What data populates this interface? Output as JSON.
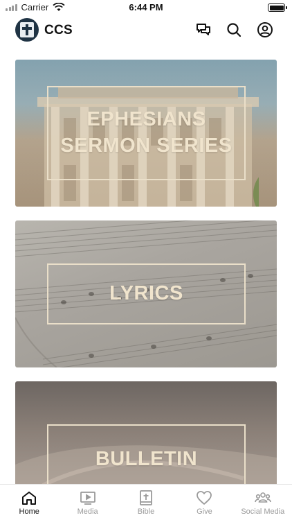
{
  "status_bar": {
    "carrier": "Carrier",
    "time": "6:44 PM"
  },
  "header": {
    "title": "CCS"
  },
  "cards": [
    {
      "title": "EPHESIANS\nSERMON SERIES"
    },
    {
      "title": "LYRICS"
    },
    {
      "title": "BULLETIN"
    }
  ],
  "tabs": [
    {
      "label": "Home",
      "icon": "home-icon",
      "active": true
    },
    {
      "label": "Media",
      "icon": "play-screen-icon",
      "active": false
    },
    {
      "label": "Bible",
      "icon": "bible-icon",
      "active": false
    },
    {
      "label": "Give",
      "icon": "heart-icon",
      "active": false
    },
    {
      "label": "Social Media",
      "icon": "people-icon",
      "active": false
    }
  ],
  "colors": {
    "card_text": "#f0e4cd",
    "active_tab": "#111111",
    "inactive_tab": "#9a9a9a"
  }
}
